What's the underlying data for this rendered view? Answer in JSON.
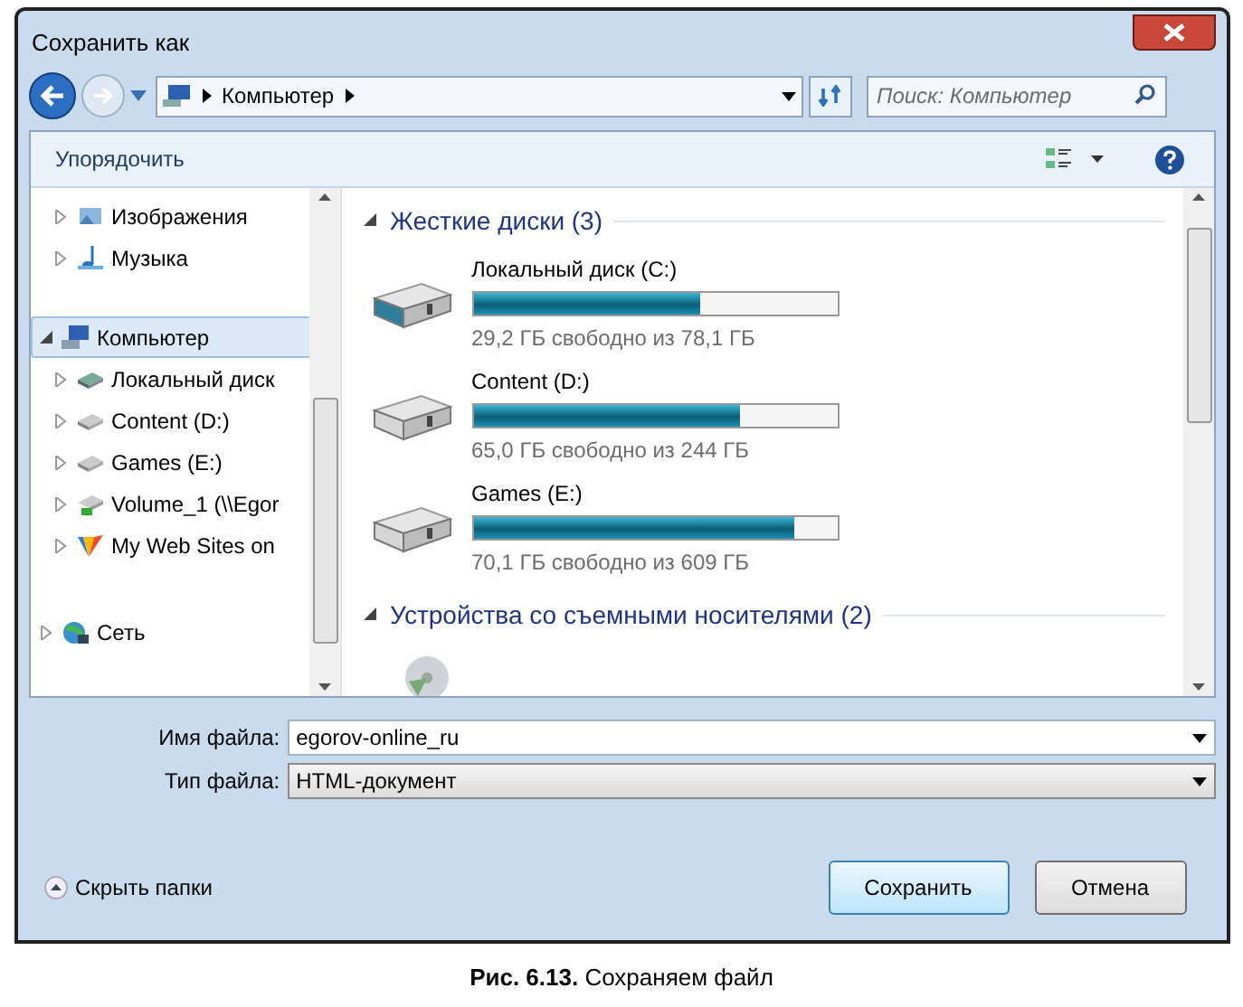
{
  "window": {
    "title": "Сохранить как"
  },
  "address": {
    "crumbs": [
      "Компьютер"
    ]
  },
  "search": {
    "placeholder": "Поиск: Компьютер"
  },
  "toolbar": {
    "organize": "Упорядочить"
  },
  "sidebar": {
    "items": [
      {
        "label": "Изображения",
        "selected": false,
        "expanded": false
      },
      {
        "label": "Музыка",
        "selected": false,
        "expanded": false
      },
      {
        "label": "Компьютер",
        "selected": true,
        "expanded": true,
        "children": [
          {
            "label": "Локальный диск",
            "selected": false,
            "expanded": false
          },
          {
            "label": "Content (D:)",
            "selected": false,
            "expanded": false
          },
          {
            "label": "Games (E:)",
            "selected": false,
            "expanded": false
          },
          {
            "label": "Volume_1 (\\\\Egor",
            "selected": false,
            "expanded": false
          },
          {
            "label": "My Web Sites on",
            "selected": false,
            "expanded": false
          }
        ]
      },
      {
        "label": "Сеть",
        "selected": false,
        "expanded": false
      }
    ]
  },
  "groups": [
    {
      "title": "Жесткие диски (3)",
      "expanded": true,
      "items": [
        {
          "name": "Локальный диск (C:)",
          "level": 0.626,
          "reading": "29,2 ГБ свободно из 78,1 ГБ"
        },
        {
          "name": "Content (D:)",
          "level": 0.734,
          "reading": "65,0 ГБ свободно из 244 ГБ"
        },
        {
          "name": "Games (E:)",
          "level": 0.885,
          "reading": "70,1 ГБ свободно из 609 ГБ"
        }
      ]
    },
    {
      "title": "Устройства со съемными носителями (2)",
      "expanded": true
    }
  ],
  "fields": [
    {
      "label": "Имя файла:",
      "value": "egorov-online_ru",
      "kind": "combo"
    },
    {
      "label": "Тип файла:",
      "value": "HTML-документ",
      "kind": "select"
    }
  ],
  "hide_folders": "Скрыть папки",
  "buttons": [
    {
      "label": "Сохранить",
      "focused": true
    },
    {
      "label": "Отмена",
      "focused": false
    }
  ],
  "caption": "**Рис. 6.13.** Сохраняем файл"
}
